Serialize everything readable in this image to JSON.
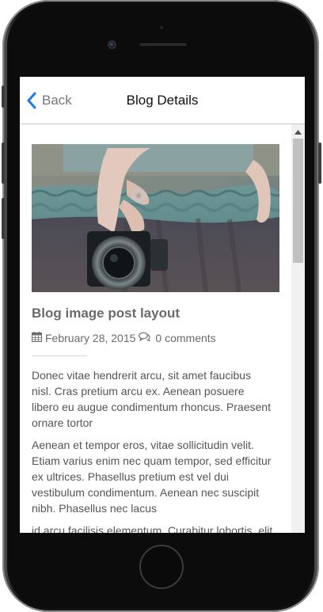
{
  "navbar": {
    "back_label": "Back",
    "title": "Blog Details"
  },
  "post": {
    "title": "Blog image post layout",
    "date": "February 28, 2015",
    "comments": "0 comments",
    "paragraphs": [
      "Donec vitae hendrerit arcu, sit amet faucibus nisl. Cras pretium arcu ex. Aenean posuere libero eu augue condimentum rhoncus. Praesent ornare tortor",
      "Aenean et tempor eros, vitae sollicitudin velit. Etiam varius enim nec quam tempor, sed efficitur ex ultrices. Phasellus pretium est vel dui vestibulum condimentum. Aenean nec suscipit nibh. Phasellus nec lacus",
      "id arcu facilisis elementum. Curabitur lobortis, elit"
    ]
  },
  "icons": {
    "back": "chevron-left-icon",
    "date": "calendar-icon",
    "comments": "comments-icon",
    "scroll_up": "arrow-up-icon"
  },
  "colors": {
    "accent": "#1a7ee6",
    "text_muted": "#6b6b6b",
    "body_text": "#555555"
  }
}
